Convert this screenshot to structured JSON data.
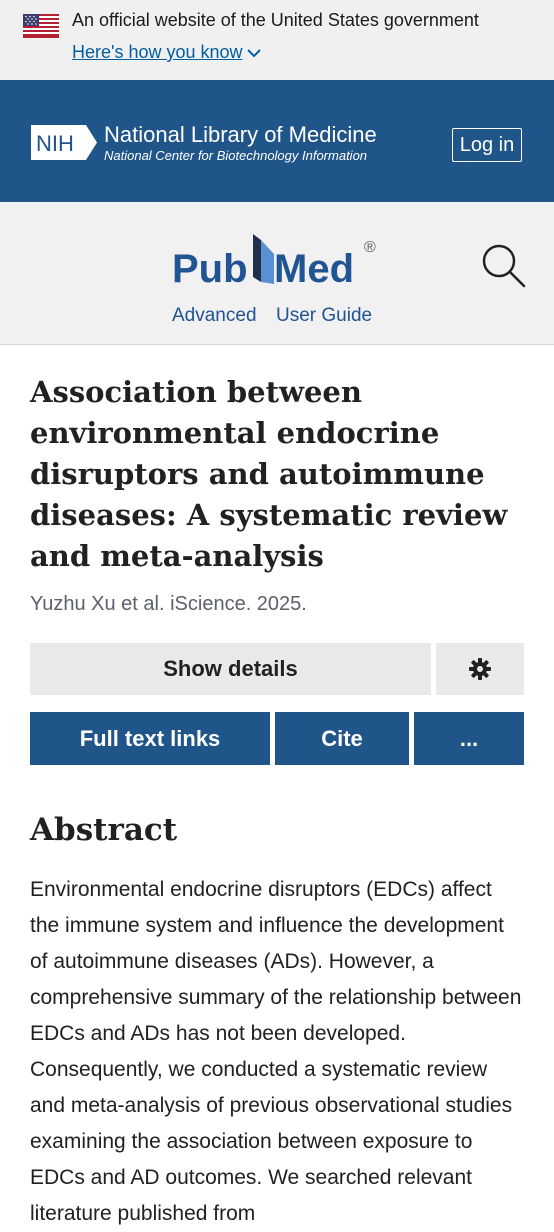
{
  "gov_banner": {
    "text": "An official website of the United States government",
    "link": "Here's how you know",
    "flag_icon": "us-flag-icon",
    "chevron_icon": "chevron-down-icon"
  },
  "nlm_header": {
    "logo_text": "NIH",
    "title": "National Library of Medicine",
    "subtitle": "National Center for Biotechnology Information",
    "login_label": "Log in"
  },
  "pubmed_header": {
    "logo_text_left": "Pub",
    "logo_text_right": "Med",
    "registered_mark": "®",
    "advanced_label": "Advanced",
    "user_guide_label": "User Guide",
    "search_icon": "search-icon"
  },
  "article": {
    "title": "Association between environmental endocrine disruptors and autoimmune diseases: A systematic review and meta-analysis",
    "citation": "Yuzhu Xu et al. iScience. 2025."
  },
  "actions": {
    "show_details_label": "Show details",
    "settings_icon": "gear-icon",
    "full_text_label": "Full text links",
    "cite_label": "Cite",
    "more_label": "..."
  },
  "abstract": {
    "heading": "Abstract",
    "text": "Environmental endocrine disruptors (EDCs) affect the immune system and influence the development of autoimmune diseases (ADs). However, a comprehensive summary of the relationship between EDCs and ADs has not been developed. Consequently, we conducted a systematic review and meta-analysis of previous observational studies examining the association between exposure to EDCs and AD outcomes. We searched relevant literature published from"
  },
  "colors": {
    "nlm_blue": "#20558a",
    "link_blue": "#205493",
    "gov_link_blue": "#005ea2",
    "pubmed_light_blue": "#5a8fd1",
    "gray_button": "#e9e9e9"
  }
}
